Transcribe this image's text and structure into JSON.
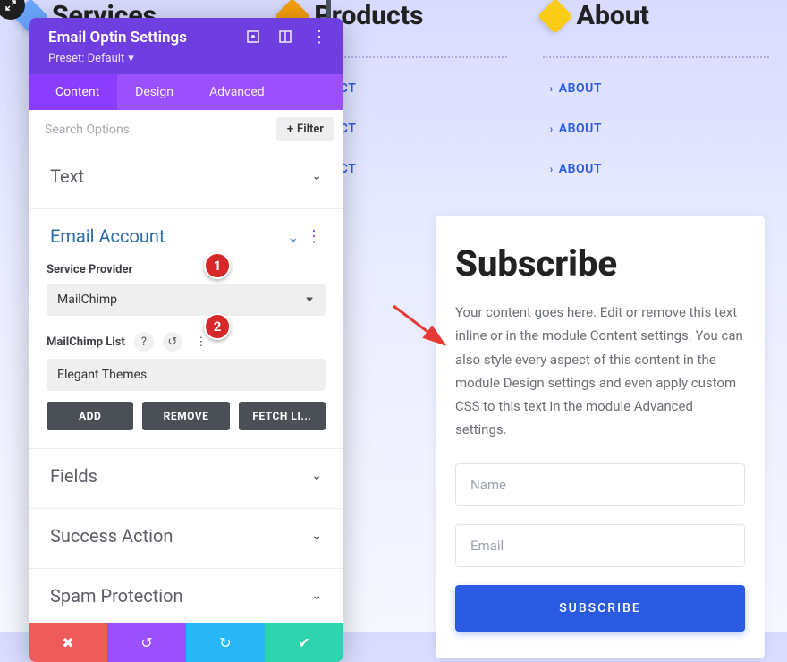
{
  "bg": {
    "col1": {
      "heading": "Services"
    },
    "col2": {
      "heading": "Products",
      "links": [
        "PRODUCT",
        "PRODUCT",
        "PRODUCT"
      ]
    },
    "col3": {
      "heading": "About",
      "links": [
        "ABOUT",
        "ABOUT",
        "ABOUT"
      ]
    }
  },
  "subscribe": {
    "title": "Subscribe",
    "body": "Your content goes here. Edit or remove this text inline or in the module Content settings. You can also style every aspect of this content in the module Design settings and even apply custom CSS to this text in the module Advanced settings.",
    "name_placeholder": "Name",
    "email_placeholder": "Email",
    "button": "SUBSCRIBE"
  },
  "panel": {
    "title": "Email Optin Settings",
    "preset_label": "Preset: Default",
    "tabs": {
      "content": "Content",
      "design": "Design",
      "advanced": "Advanced"
    },
    "search_placeholder": "Search Options",
    "filter_label": "Filter",
    "sections": {
      "text": "Text",
      "email_account": "Email Account",
      "fields": "Fields",
      "success_action": "Success Action",
      "spam_protection": "Spam Protection"
    },
    "email_account": {
      "service_provider_label": "Service Provider",
      "service_provider_value": "MailChimp",
      "mailchimp_list_label": "MailChimp List",
      "mailchimp_list_value": "Elegant Themes",
      "add": "ADD",
      "remove": "REMOVE",
      "fetch": "FETCH LI..."
    }
  },
  "badges": {
    "one": "1",
    "two": "2"
  }
}
